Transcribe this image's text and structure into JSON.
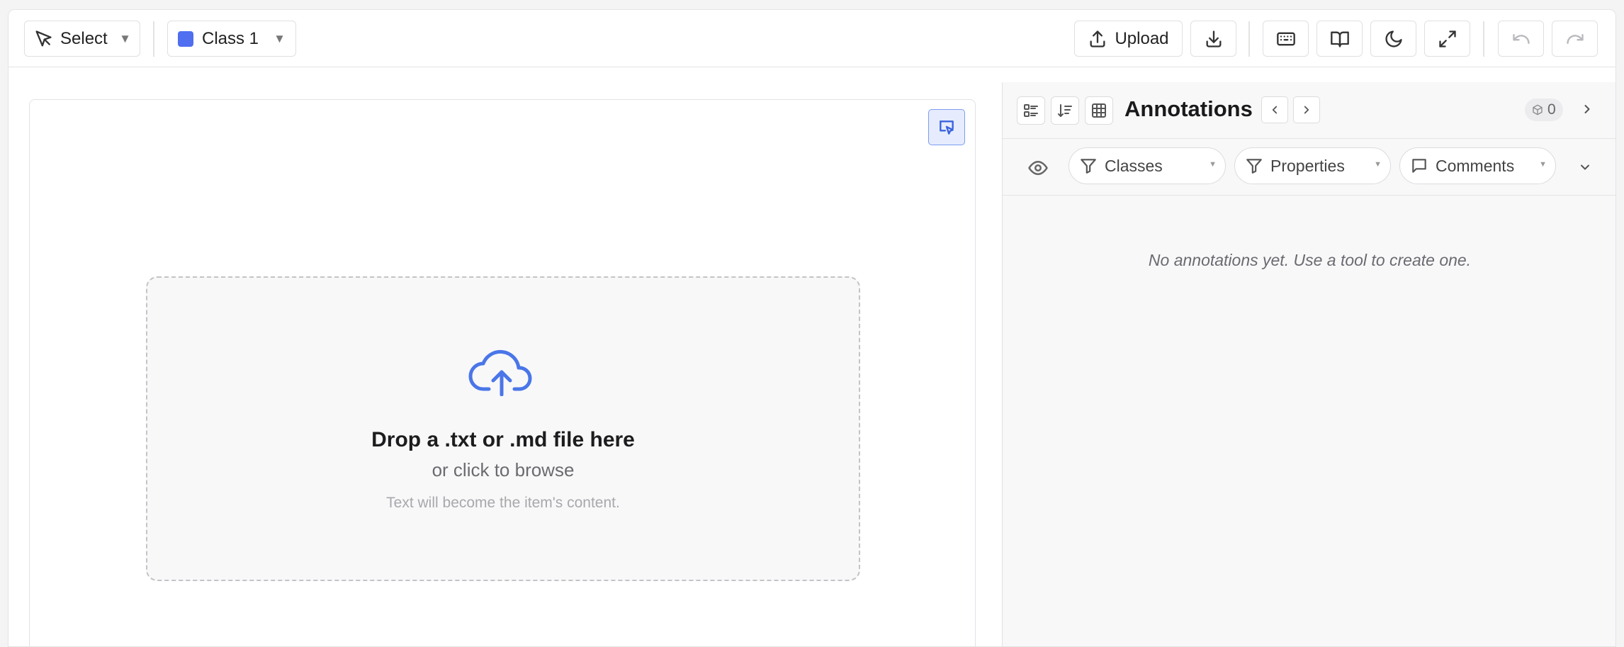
{
  "toolbar": {
    "tool_select": {
      "label": "Select",
      "icon": "cursor-arrow-icon"
    },
    "class_select": {
      "label": "Class 1",
      "color": "#4f6ef0"
    },
    "upload": {
      "label": "Upload",
      "icon": "upload-icon"
    },
    "download": {
      "icon": "download-icon"
    },
    "keyboard": {
      "icon": "keyboard-icon"
    },
    "docs": {
      "icon": "book-open-icon"
    },
    "theme": {
      "icon": "moon-icon"
    },
    "fullscreen": {
      "icon": "expand-icon"
    },
    "undo": {
      "icon": "undo-icon",
      "enabled": false
    },
    "redo": {
      "icon": "redo-icon",
      "enabled": false
    }
  },
  "editor": {
    "dropzone": {
      "title": "Drop a .txt or .md file here",
      "subtitle": "or click to browse",
      "hint": "Text will become the item's content."
    }
  },
  "annotations_panel": {
    "title": "Annotations",
    "count": "0",
    "filters": {
      "classes": "Classes",
      "properties": "Properties",
      "comments": "Comments"
    },
    "empty_message": "No annotations yet. Use a tool to create one."
  },
  "colors": {
    "accent": "#4a76e8",
    "class1": "#4f6ef0"
  }
}
